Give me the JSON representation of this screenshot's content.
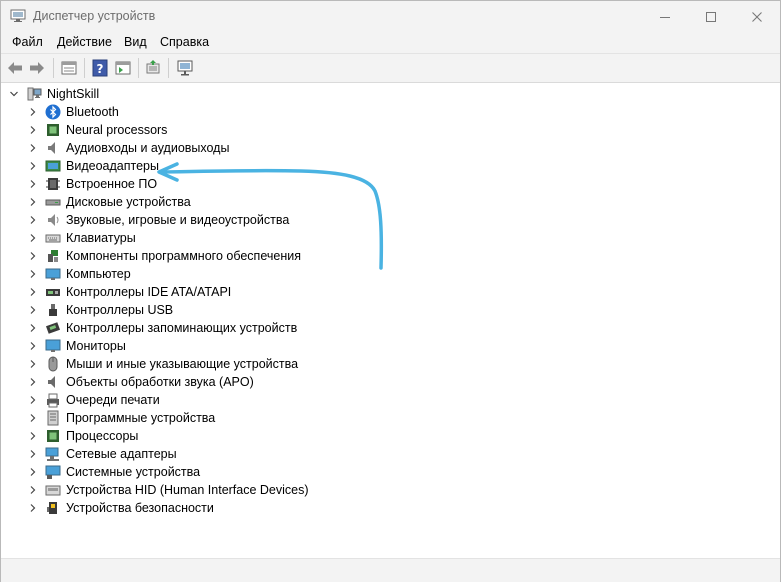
{
  "window": {
    "title": "Диспетчер устройств"
  },
  "menu": [
    "Файл",
    "Действие",
    "Вид",
    "Справка"
  ],
  "toolbar": [
    "back-icon",
    "forward-icon",
    "properties-icon",
    "help-icon",
    "view-icon",
    "update-driver-icon",
    "scan-hardware-icon"
  ],
  "tree": {
    "root": "NightSkill",
    "items": [
      "Bluetooth",
      "Neural processors",
      "Аудиовходы и аудиовыходы",
      "Видеоадаптеры",
      "Встроенное ПО",
      "Дисковые устройства",
      "Звуковые, игровые и видеоустройства",
      "Клавиатуры",
      "Компоненты программного обеспечения",
      "Компьютер",
      "Контроллеры IDE ATA/ATAPI",
      "Контроллеры USB",
      "Контроллеры запоминающих устройств",
      "Мониторы",
      "Мыши и иные указывающие устройства",
      "Объекты обработки звука (APO)",
      "Очереди печати",
      "Программные устройства",
      "Процессоры",
      "Сетевые адаптеры",
      "Системные устройства",
      "Устройства HID (Human Interface Devices)",
      "Устройства безопасности"
    ]
  },
  "colors": {
    "annotation_arrow": "#4ab3e2",
    "accent": "#0078d4"
  }
}
